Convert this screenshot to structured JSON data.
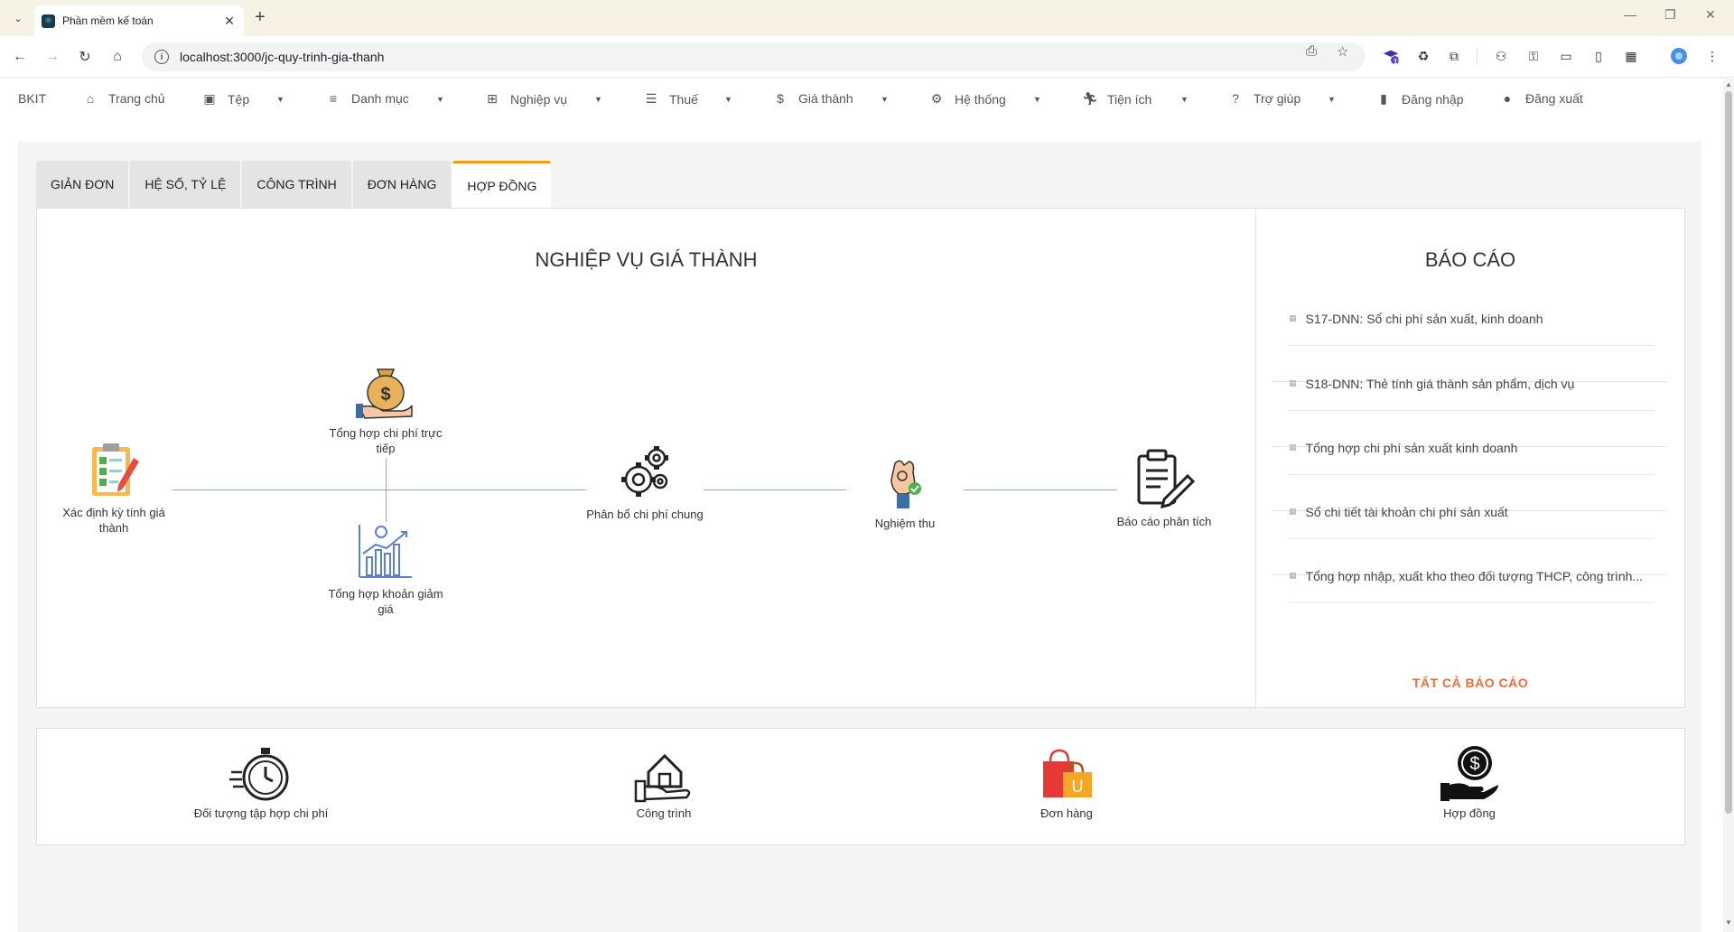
{
  "browser": {
    "tab_title": "Phần mềm kế toán",
    "url": "localhost:3000/jc-quy-trinh-gia-thanh",
    "extension_badge": "11"
  },
  "menu": {
    "brand": "BKIT",
    "items": [
      {
        "label": "Trang chủ",
        "icon": "home-icon"
      },
      {
        "label": "Tệp",
        "icon": "save-icon"
      },
      {
        "label": "Danh mục",
        "icon": "list-icon"
      },
      {
        "label": "Nghiệp vụ",
        "icon": "grid-icon"
      },
      {
        "label": "Thuế",
        "icon": "checklist-icon"
      },
      {
        "label": "Giá thành",
        "icon": "dollar-circle-icon"
      },
      {
        "label": "Hệ thống",
        "icon": "gear-icon"
      },
      {
        "label": "Tiện ích",
        "icon": "run-icon"
      },
      {
        "label": "Trợ giúp",
        "icon": "help-icon"
      },
      {
        "label": "Đăng nhập",
        "icon": "login-icon"
      },
      {
        "label": "Đăng xuất",
        "icon": "logout-icon"
      }
    ]
  },
  "tabs": [
    "GIẢN ĐƠN",
    "HỆ SỐ, TỶ LỆ",
    "CÔNG TRÌNH",
    "ĐƠN HÀNG",
    "HỢP ĐỒNG"
  ],
  "active_tab": "HỢP ĐỒNG",
  "process": {
    "title": "NGHIỆP VỤ GIÁ THÀNH",
    "nodes": {
      "xac_dinh": "Xác định kỳ tính giá thành",
      "chi_phi_truc_tiep": "Tổng hợp chi phí trực tiếp",
      "khoan_giam_gia": "Tổng hợp khoản giảm giá",
      "phan_bo": "Phân bổ chi phí chung",
      "nghiem_thu": "Nghiệm thu",
      "bao_cao_phan_tich": "Báo cáo phân tích"
    }
  },
  "reports": {
    "title": "BÁO CÁO",
    "items": [
      "S17-DNN: Sổ chi phí sản xuất, kinh doanh",
      "S18-DNN: Thẻ tính giá thành sản phẩm, dịch vụ",
      "Tổng hợp chi phí sản xuất kinh doanh",
      "Sổ chi tiết tài khoản chi phí sản xuất",
      "Tổng hợp nhập, xuất kho theo đối tượng THCP, công trình..."
    ],
    "all_label": "TẤT CẢ BÁO CÁO"
  },
  "shortcuts": [
    "Đối tượng tập hợp chi phí",
    "Công trình",
    "Đơn hàng",
    "Hợp đồng"
  ],
  "colors": {
    "accent_tab": "#f39c12",
    "report_link": "#f26b3a",
    "flow_line": "#9aa7b6"
  }
}
